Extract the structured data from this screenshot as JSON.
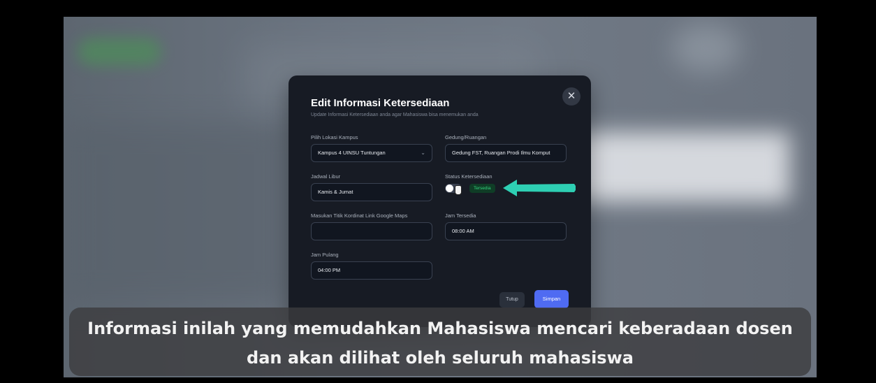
{
  "modal": {
    "title": "Edit Informasi Ketersediaan",
    "subtitle": "Update Informasi Ketersediaan anda agar Mahasiswa bisa menemukan anda",
    "close_icon": "close-icon",
    "fields": {
      "lokasi": {
        "label": "Pilih Lokasi Kampus",
        "value": "Kampus 4 UINSU Tuntungan"
      },
      "gedung": {
        "label": "Gedung/Ruangan",
        "value": "Gedung FST, Ruangan Prodi Ilmu Komput"
      },
      "jadwal": {
        "label": "Jadwal Libur",
        "value": "Kamis & Jumat"
      },
      "status": {
        "label": "Status Ketersediaan",
        "badge": "Tersedia",
        "enabled": true
      },
      "maps": {
        "label": "Masukan Titik Kordinat Link Google Maps",
        "value": ""
      },
      "jam_tersedia": {
        "label": "Jam Tersedia",
        "value": "08:00 AM"
      },
      "jam_pulang": {
        "label": "Jam Pulang",
        "value": "04:00 PM"
      }
    },
    "buttons": {
      "close": "Tutup",
      "save": "Simpan"
    }
  },
  "caption": {
    "line1": "Informasi inilah yang memudahkan Mahasiswa mencari keberadaan dosen",
    "line2": "dan akan dilihat oleh seluruh mahasiswa"
  },
  "colors": {
    "accent": "#4f6bf2",
    "status": "#34d37e",
    "arrow": "#2ecfb3"
  }
}
